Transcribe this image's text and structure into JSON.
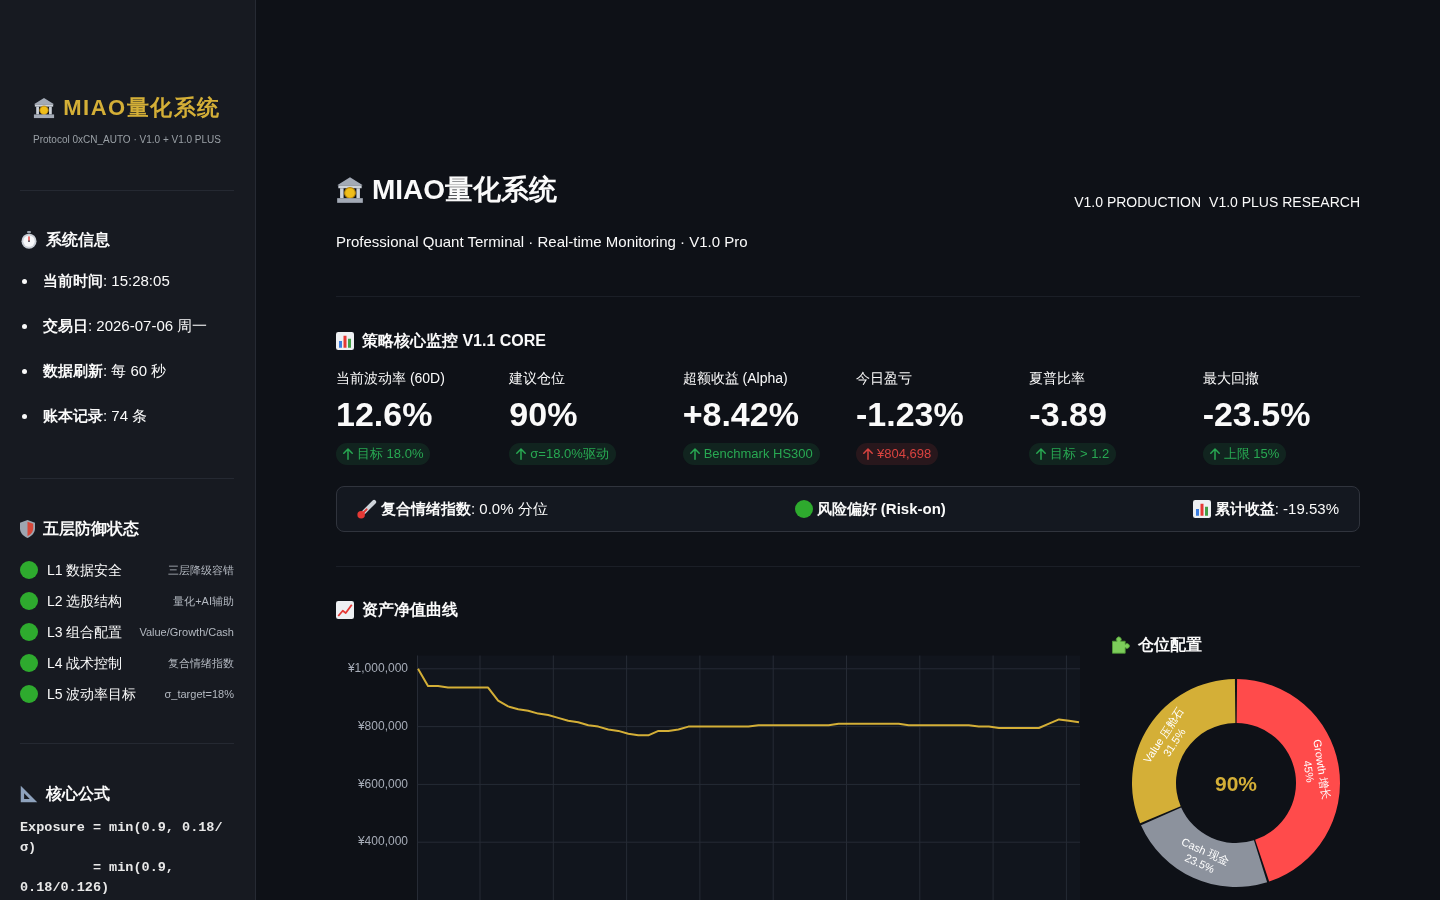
{
  "sidebar": {
    "logo": "MIAO量化系统",
    "protocol": "Protocol 0xCN_AUTO · V1.0 + V1.0 PLUS",
    "system_info": {
      "title": "系统信息",
      "items": [
        "**当前时间**: 15:28:05",
        "**交易日**: 2026-07-06 周一",
        "**数据刷新**: 每 60 秒",
        "**账本记录**: 74 条"
      ]
    },
    "defense": {
      "title": "五层防御状态",
      "layers": [
        {
          "name": "L1 数据安全",
          "detail": "三层降级容错",
          "color": "#2eaa2e"
        },
        {
          "name": "L2 选股结构",
          "detail": "量化+AI辅助",
          "color": "#2eaa2e"
        },
        {
          "name": "L3 组合配置",
          "detail": "Value/Growth/Cash",
          "color": "#2eaa2e"
        },
        {
          "name": "L4 战术控制",
          "detail": "复合情绪指数",
          "color": "#2eaa2e"
        },
        {
          "name": "L5 波动率目标",
          "detail": "σ_target=18%",
          "color": "#2eaa2e"
        }
      ]
    },
    "formula": {
      "title": "核心公式",
      "lines": [
        "Exposure = min(0.9, 0.18/σ)",
        "         = min(0.9, 0.18/0.126)"
      ]
    }
  },
  "header": {
    "title": "MIAO量化系统",
    "tags": [
      "V1.0 PRODUCTION",
      "V1.0 PLUS RESEARCH"
    ],
    "subtitle": "Professional Quant Terminal · Real-time Monitoring · V1.0 Pro"
  },
  "monitor": {
    "title": "策略核心监控 V1.1 CORE",
    "metrics": [
      {
        "label": "当前波动率 (60D)",
        "value": "12.6%",
        "delta": {
          "text": "目标 18.0%",
          "color": "#28a852"
        }
      },
      {
        "label": "建议仓位",
        "value": "90%",
        "delta": {
          "text": "σ=18.0%驱动",
          "color": "#28a852"
        }
      },
      {
        "label": "超额收益 (Alpha)",
        "value": "+8.42%",
        "delta": {
          "text": "Benchmark HS300",
          "color": "#28a852"
        }
      },
      {
        "label": "今日盈亏",
        "value": "-1.23%",
        "delta": {
          "text": "¥804,698",
          "color": "#d9433f"
        }
      },
      {
        "label": "夏普比率",
        "value": "-3.89",
        "delta": {
          "text": "目标 > 1.2",
          "color": "#28a852"
        }
      },
      {
        "label": "最大回撤",
        "value": "-23.5%",
        "delta": {
          "text": "上限 15%",
          "color": "#28a852"
        }
      }
    ]
  },
  "status_bar": {
    "sentiment": "**复合情绪指数**: 0.0% 分位",
    "risk": {
      "text": "风险偏好 (Risk-on)",
      "color": "#2eaa2e"
    },
    "cumulative_return": "**累计收益**: -19.53%"
  },
  "equity_curve": {
    "title": "资产净值曲线",
    "chart_data": {
      "type": "line",
      "grid": true,
      "ylim": [
        200000,
        1046000
      ],
      "yticks": [
        {
          "value": 400000,
          "label": "¥400,000"
        },
        {
          "value": 600000,
          "label": "¥600,000"
        },
        {
          "value": 800000,
          "label": "¥800,000"
        },
        {
          "value": 1000000,
          "label": "¥1,000,000"
        }
      ],
      "series": [
        {
          "color": "#d4af37",
          "values": [
            1000000,
            940000,
            940000,
            935000,
            935000,
            935000,
            935000,
            935000,
            890000,
            870000,
            860000,
            855000,
            845000,
            840000,
            830000,
            820000,
            815000,
            805000,
            800000,
            790000,
            785000,
            775000,
            770000,
            770000,
            785000,
            785000,
            790000,
            800000,
            800000,
            800000,
            800000,
            800000,
            800000,
            800000,
            805000,
            805000,
            805000,
            805000,
            805000,
            805000,
            805000,
            805000,
            810000,
            810000,
            810000,
            810000,
            810000,
            810000,
            810000,
            805000,
            805000,
            805000,
            805000,
            805000,
            805000,
            805000,
            800000,
            800000,
            795000,
            795000,
            795000,
            795000,
            795000,
            810000,
            825000,
            820000,
            815000
          ]
        }
      ]
    }
  },
  "allocation": {
    "title": "仓位配置",
    "chart_data": {
      "type": "donut",
      "categories": [
        "Growth 增长",
        "Cash 现金",
        "Value 压舱石"
      ],
      "values": [
        45,
        23.5,
        31.5
      ],
      "colors": [
        "#ff4b4b",
        "#8c929d",
        "#d4af37"
      ],
      "value_labels": [
        "45%",
        "23.5%",
        "31.5%"
      ],
      "annotations": [
        {
          "text": "90%"
        }
      ]
    }
  }
}
